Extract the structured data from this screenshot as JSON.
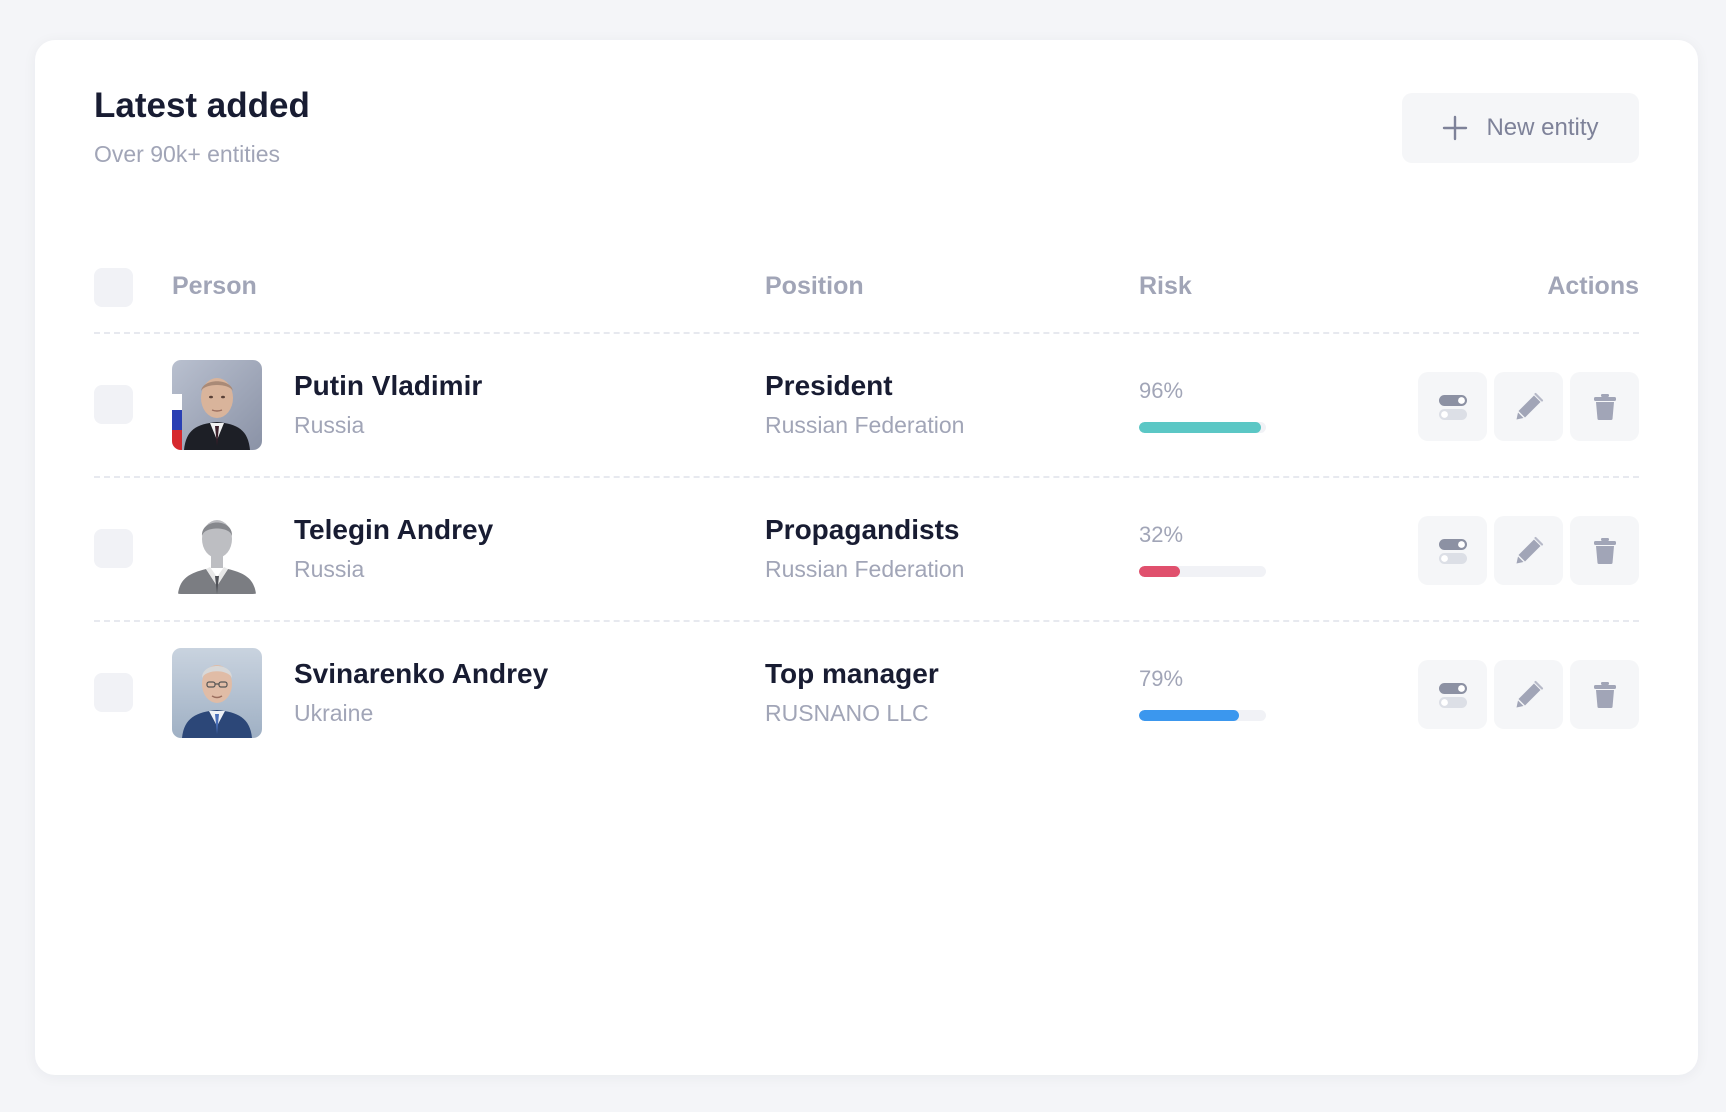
{
  "header": {
    "title": "Latest added",
    "subtitle": "Over 90k+ entities",
    "new_button_label": "New entity"
  },
  "table": {
    "columns": {
      "person": "Person",
      "position": "Position",
      "risk": "Risk",
      "actions": "Actions"
    },
    "rows": [
      {
        "name": "Putin Vladimir",
        "country": "Russia",
        "position": "President",
        "organization": "Russian Federation",
        "risk_label": "96%",
        "risk": 0.96,
        "risk_color": "#5bc7c5",
        "avatar": "photo"
      },
      {
        "name": "Telegin Andrey",
        "country": "Russia",
        "position": "Propagandists",
        "organization": "Russian Federation",
        "risk_label": "32%",
        "risk": 0.32,
        "risk_color": "#e0506d",
        "avatar": "placeholder-silhouette"
      },
      {
        "name": "Svinarenko Andrey",
        "country": "Ukraine",
        "position": "Top manager",
        "organization": "RUSNANO LLC",
        "risk_label": "79%",
        "risk": 0.79,
        "risk_color": "#3b97ee",
        "avatar": "photo"
      }
    ]
  },
  "icons": {
    "new": "plus-icon",
    "toggle": "toggle-icon",
    "edit": "pencil-icon",
    "delete": "trash-icon"
  }
}
